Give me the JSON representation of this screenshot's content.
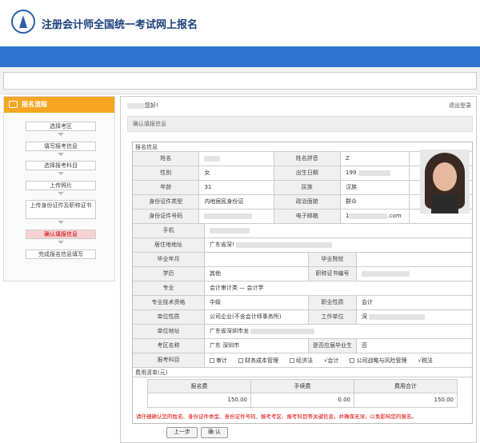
{
  "header": {
    "title": "注册会计师全国统一考试网上报名"
  },
  "sidebar": {
    "title": "报名流程",
    "steps": [
      "选择考区",
      "填写报考信息",
      "选择报考科目",
      "上传照片",
      "上传身份证件及职称证书",
      "确认填报信息",
      "完成报名信息填写"
    ],
    "active_step": 5
  },
  "main": {
    "greeting": "您好!",
    "logout": "退出登录",
    "confirm_title": "确认填报信息",
    "section_title": "报名信息",
    "rows": {
      "name_label": "姓名",
      "name_pinyin_label": "姓名拼音",
      "name_pinyin_value": "Z",
      "gender_label": "性别",
      "gender_value": "女",
      "birth_label": "出生日期",
      "birth_value": "199",
      "age_label": "年龄",
      "age_value": "31",
      "ethnic_label": "民族",
      "ethnic_value": "汉族",
      "idtype_label": "身份证件类型",
      "idtype_value": "内地居民身份证",
      "political_label": "政治面貌",
      "political_value": "群众",
      "idno_label": "身份证件号码",
      "email_label": "电子邮箱",
      "email_value_prefix": "1",
      "email_value_suffix": ".com",
      "phone_label": "手机",
      "address_label": "居住地地址",
      "address_value": "广东省深!",
      "grad_label": "毕业年月",
      "school_label": "毕业院校",
      "edu_label": "学历",
      "edu_value": "其他",
      "cert_label": "职称证书编号",
      "major_label": "专业",
      "major_value": "会计审计类 — 会计学",
      "title_label": "专业技术资格",
      "title_value": "中级",
      "job_label": "职业性质",
      "job_value": "会计",
      "unit_type_label": "单位性质",
      "unit_type_value": "公司企业(不含会计师事务所)",
      "work_unit_label": "工作单位",
      "work_unit_value": "深",
      "unit_addr_label": "单位地址",
      "unit_addr_value": "广东省深圳市龙",
      "exam_area_label": "考区名称",
      "exam_area_value": "广东 深圳市",
      "fresh_grad_label": "是否应届毕业生",
      "fresh_grad_value": "否",
      "subjects_label": "报考科目"
    },
    "subjects": [
      {
        "name": "审计",
        "checked": false
      },
      {
        "name": "财务成本管理",
        "checked": false
      },
      {
        "name": "经济法",
        "checked": false
      },
      {
        "name": "会计",
        "checked": true
      },
      {
        "name": "公司战略与风险管理",
        "checked": false
      },
      {
        "name": "税法",
        "checked": true
      }
    ],
    "fee": {
      "title": "费用清单(元)",
      "headers": [
        "报名费",
        "手续费",
        "费用合计"
      ],
      "values": [
        "150.00",
        "0.00",
        "150.00"
      ]
    },
    "notice": "请仔细确认您的姓名、身份证件类型、身份证件号码、报考考区、报考科目等关键信息，并确保无误，以免影响您的报名。",
    "buttons": {
      "prev": "上一步",
      "confirm": "确 认"
    }
  }
}
